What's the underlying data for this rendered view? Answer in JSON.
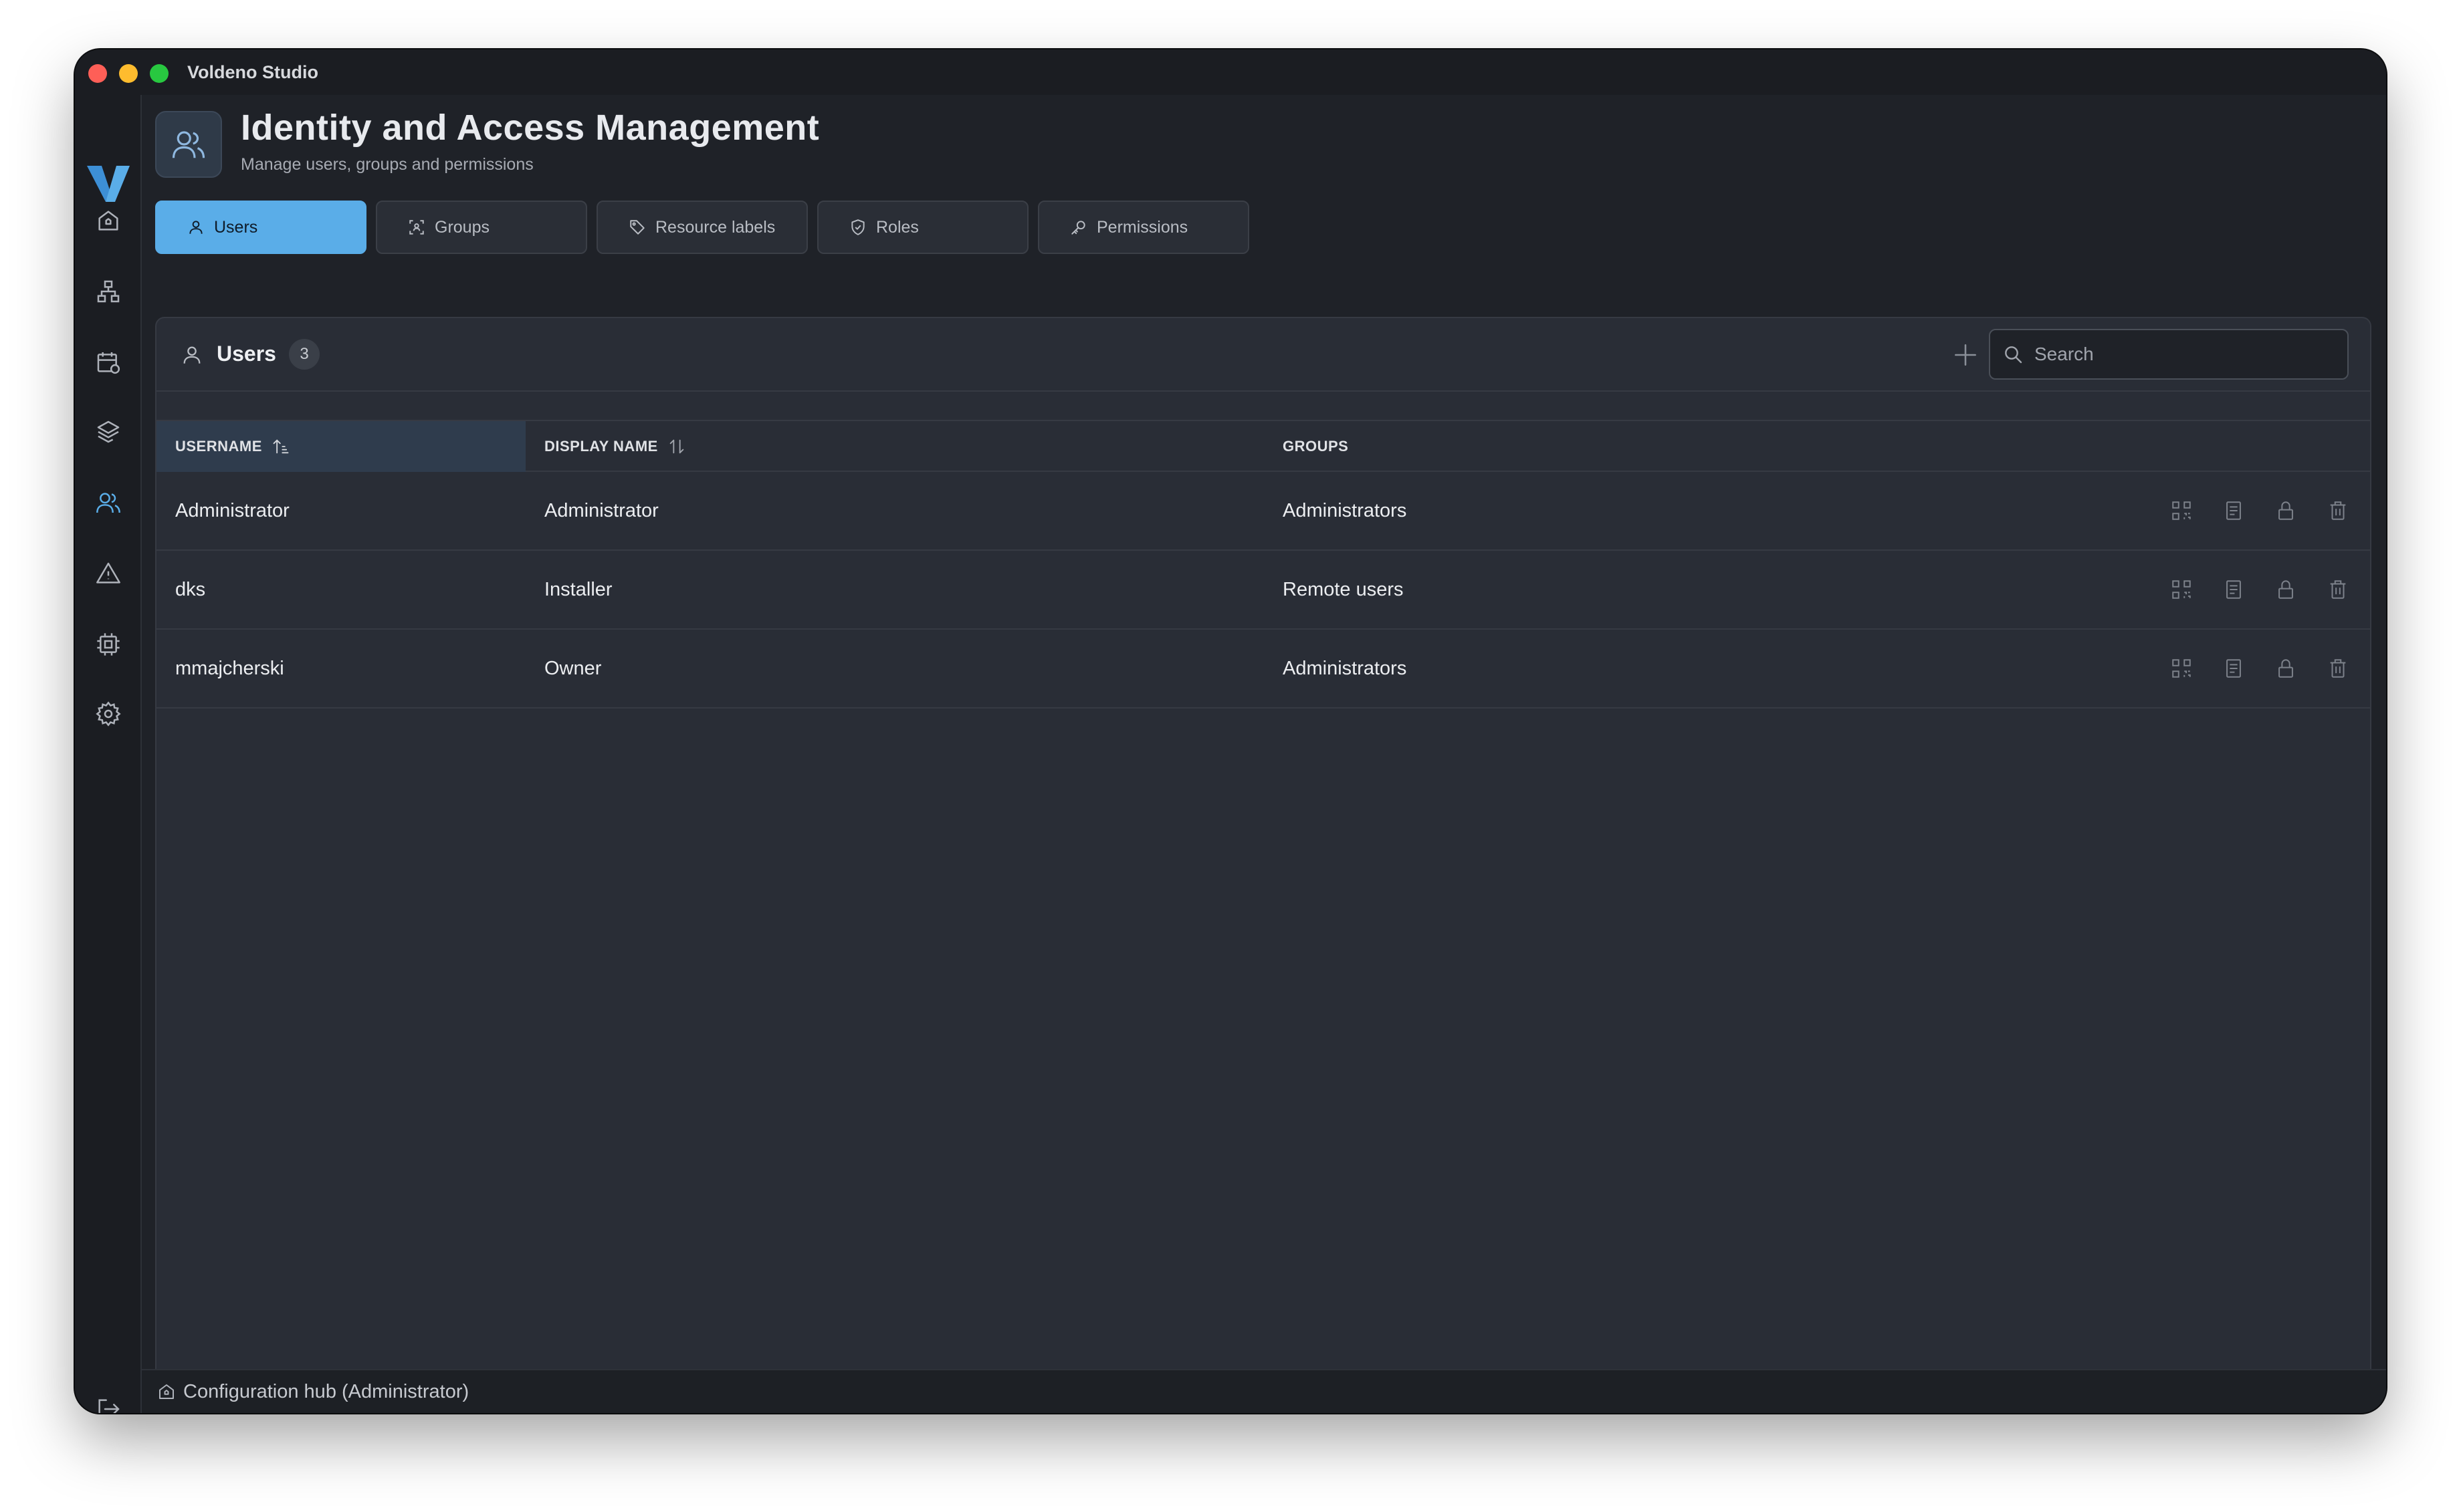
{
  "app": {
    "title": "Voldeno Studio",
    "accent_color": "#5aade8"
  },
  "sidebar": {
    "items": [
      {
        "name": "home",
        "icon": "home-icon"
      },
      {
        "name": "network",
        "icon": "network-icon"
      },
      {
        "name": "schedule",
        "icon": "calendar-icon"
      },
      {
        "name": "layers",
        "icon": "layers-icon"
      },
      {
        "name": "users",
        "icon": "users-icon",
        "active": true
      },
      {
        "name": "alerts",
        "icon": "warning-icon"
      },
      {
        "name": "hardware",
        "icon": "chip-icon"
      },
      {
        "name": "settings",
        "icon": "gear-icon"
      }
    ],
    "logout_icon": "logout-icon"
  },
  "header": {
    "title": "Identity and Access Management",
    "subtitle": "Manage users, groups and permissions"
  },
  "tabs": [
    {
      "label": "Users",
      "icon": "user-icon",
      "active": true
    },
    {
      "label": "Groups",
      "icon": "group-icon",
      "active": false
    },
    {
      "label": "Resource labels",
      "icon": "tag-icon",
      "active": false
    },
    {
      "label": "Roles",
      "icon": "shield-icon",
      "active": false
    },
    {
      "label": "Permissions",
      "icon": "key-icon",
      "active": false
    }
  ],
  "panel": {
    "title": "Users",
    "count": "3",
    "search_placeholder": "Search"
  },
  "table": {
    "columns": [
      {
        "label": "USERNAME",
        "sort": "ascending"
      },
      {
        "label": "DISPLAY NAME",
        "sort": "none"
      },
      {
        "label": "GROUPS",
        "sort": null
      }
    ],
    "rows": [
      {
        "username": "Administrator",
        "display_name": "Administrator",
        "groups": "Administrators"
      },
      {
        "username": "dks",
        "display_name": "Installer",
        "groups": "Remote users"
      },
      {
        "username": "mmajcherski",
        "display_name": "Owner",
        "groups": "Administrators"
      }
    ],
    "row_action_icons": [
      "qr-code-icon",
      "document-icon",
      "lock-icon",
      "trash-icon"
    ]
  },
  "statusbar": {
    "text": "Configuration hub (Administrator)"
  }
}
